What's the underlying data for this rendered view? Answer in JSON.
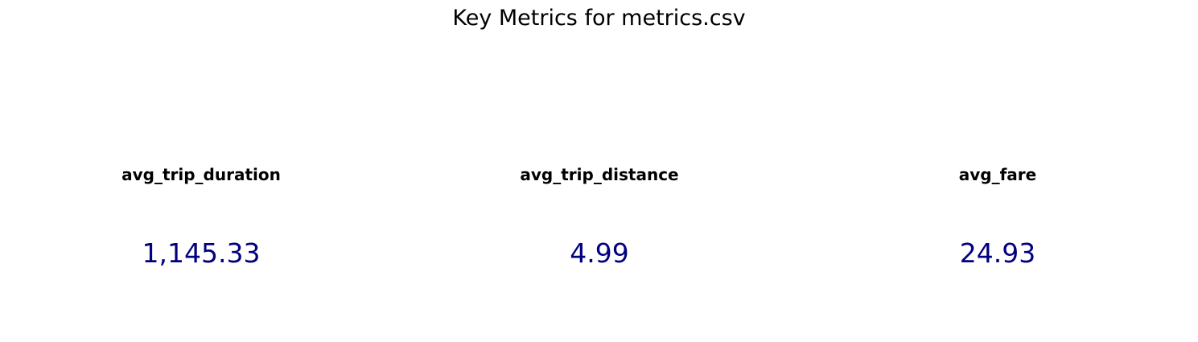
{
  "chart_data": {
    "type": "table",
    "title": "Key Metrics for metrics.csv",
    "value_color": "#000080",
    "label_color": "#000000",
    "metrics": [
      {
        "label": "avg_trip_duration",
        "value": 1145.33,
        "display": "1,145.33"
      },
      {
        "label": "avg_trip_distance",
        "value": 4.99,
        "display": "4.99"
      },
      {
        "label": "avg_fare",
        "value": 24.93,
        "display": "24.93"
      }
    ]
  }
}
